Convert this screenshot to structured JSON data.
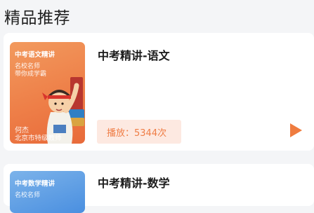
{
  "section": {
    "title": "精品推荐"
  },
  "courses": [
    {
      "title": "中考精讲-语文",
      "cover": {
        "title": "中考语文精讲",
        "line1": "名校名师",
        "line2": "带你成学霸",
        "teacher": "何杰",
        "teacher_desc": "北京市特级教师"
      },
      "play_label": "播放：5344次",
      "accent_color": "#ef7c3f",
      "play_icon": "play-triangle-icon"
    },
    {
      "title": "中考精讲-数学",
      "cover": {
        "title": "中考数学精讲",
        "line1": "名校名师"
      }
    }
  ]
}
